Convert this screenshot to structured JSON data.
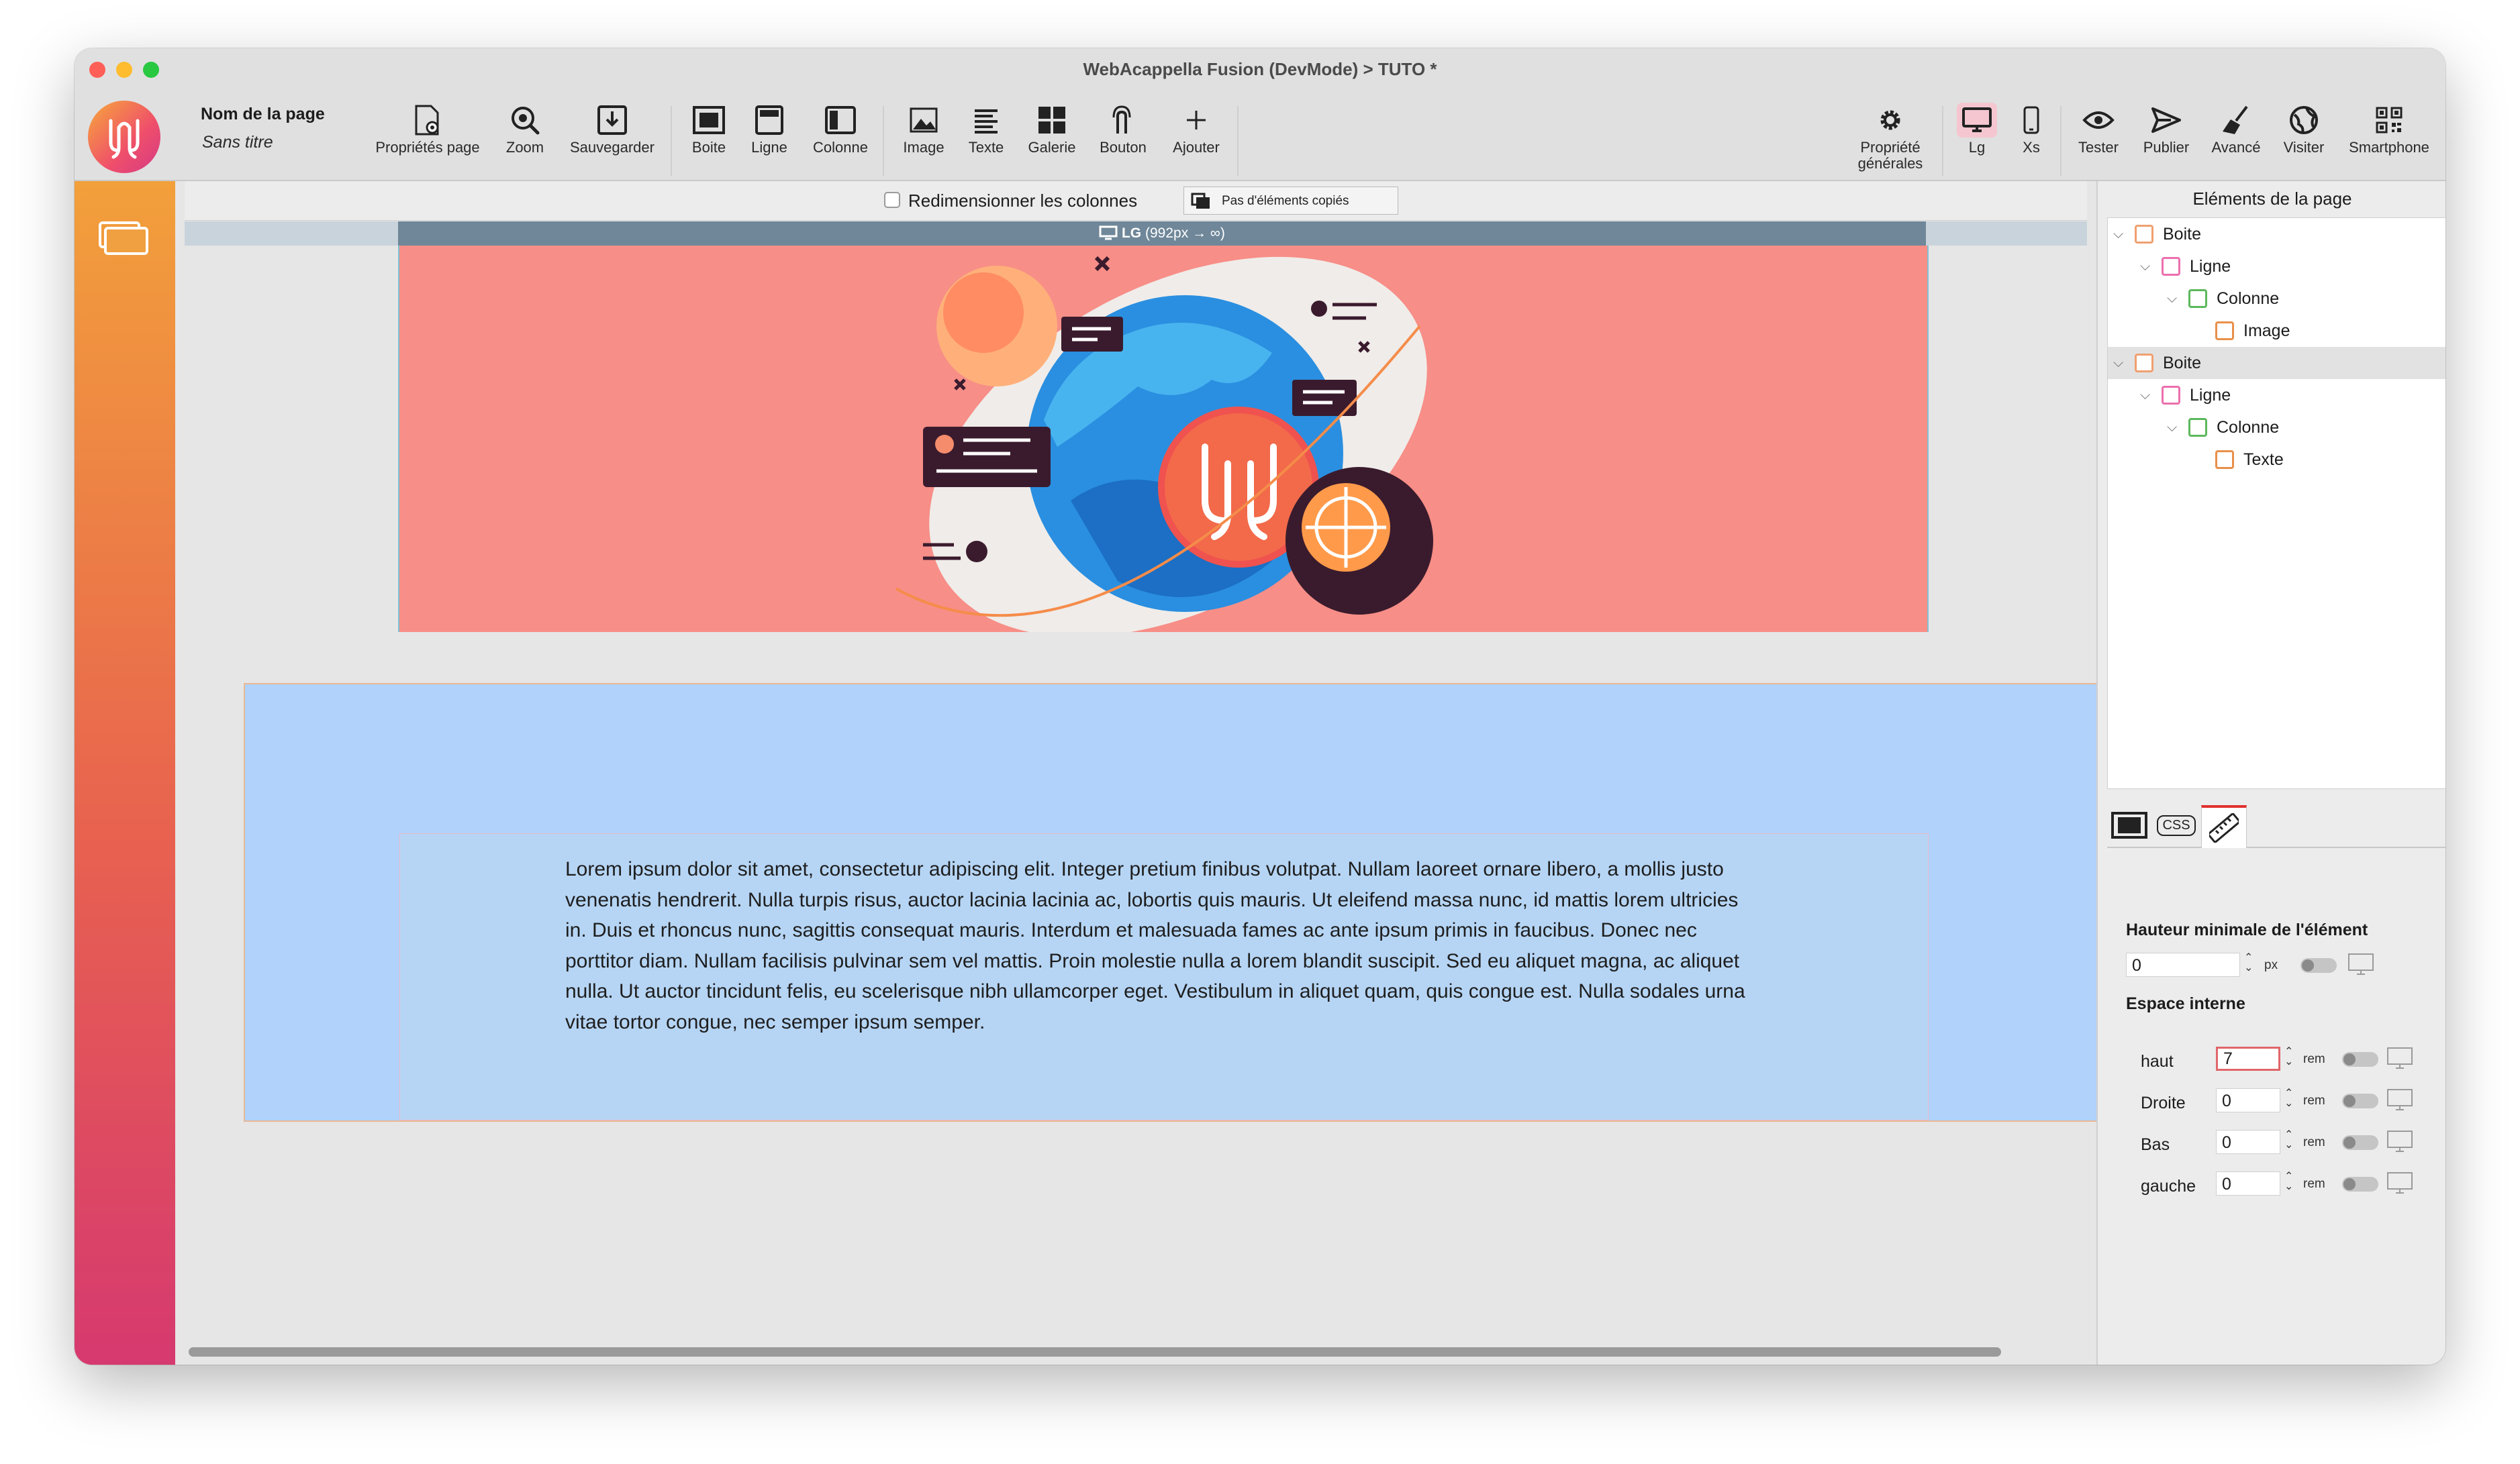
{
  "window": {
    "title": "WebAcappella Fusion (DevMode) > TUTO *"
  },
  "page": {
    "name_label": "Nom de la page",
    "subtitle": "Sans titre"
  },
  "toolbar": {
    "left": [
      {
        "id": "page-properties",
        "label": "Propriétés page",
        "icon": "page-gear-icon"
      },
      {
        "id": "zoom",
        "label": "Zoom",
        "icon": "zoom-icon"
      },
      {
        "id": "save",
        "label": "Sauvegarder",
        "icon": "save-icon"
      },
      {
        "id": "box",
        "label": "Boite",
        "icon": "box-icon"
      },
      {
        "id": "row",
        "label": "Ligne",
        "icon": "row-icon"
      },
      {
        "id": "column",
        "label": "Colonne",
        "icon": "column-icon"
      },
      {
        "id": "image",
        "label": "Image",
        "icon": "image-icon"
      },
      {
        "id": "text",
        "label": "Texte",
        "icon": "text-icon"
      },
      {
        "id": "gallery",
        "label": "Galerie",
        "icon": "gallery-icon"
      },
      {
        "id": "button",
        "label": "Bouton",
        "icon": "touch-icon"
      },
      {
        "id": "add",
        "label": "Ajouter",
        "icon": "plus-icon"
      }
    ],
    "right": [
      {
        "id": "general-props",
        "label_line1": "Propriété",
        "label_line2": "générales",
        "icon": "gear-icon"
      },
      {
        "id": "lg",
        "label": "Lg",
        "icon": "desktop-icon"
      },
      {
        "id": "xs",
        "label": "Xs",
        "icon": "phone-icon"
      },
      {
        "id": "test",
        "label": "Tester",
        "icon": "eye-icon"
      },
      {
        "id": "publish",
        "label": "Publier",
        "icon": "send-icon"
      },
      {
        "id": "advanced",
        "label": "Avancé",
        "icon": "broom-icon"
      },
      {
        "id": "visit",
        "label": "Visiter",
        "icon": "globe-icon"
      },
      {
        "id": "smartphone",
        "label": "Smartphone",
        "icon": "qr-code-icon"
      }
    ]
  },
  "canvas": {
    "resize_columns_label": "Redimensionner les colonnes",
    "copied_elements_label": "Pas d'éléments copiés",
    "breakpoint_label": "LG",
    "breakpoint_range": "(992px → ∞)",
    "lorem_text": "Lorem ipsum dolor sit amet, consectetur adipiscing elit. Integer pretium finibus volutpat. Nullam laoreet ornare libero, a mollis justo venenatis hendrerit. Nulla turpis risus, auctor lacinia lacinia ac, lobortis quis mauris. Ut eleifend massa nunc, id mattis lorem ultricies in. Duis et rhoncus nunc, sagittis consequat mauris. Interdum et malesuada fames ac ante ipsum primis in faucibus. Donec nec porttitor diam. Nullam facilisis pulvinar sem vel mattis. Proin molestie nulla a lorem blandit suscipit. Sed eu aliquet magna, ac aliquet nulla. Ut auctor tincidunt felis, eu scelerisque nibh ullamcorper eget. Vestibulum in aliquet quam, quis congue est. Nulla sodales urna vitae tortor congue, nec semper ipsum semper."
  },
  "panel": {
    "title": "Eléments de la page",
    "tree": [
      {
        "label": "Boite",
        "type": "box",
        "color": "#f0a070"
      },
      {
        "label": "Ligne",
        "type": "row",
        "color": "#ec6fae"
      },
      {
        "label": "Colonne",
        "type": "column",
        "color": "#5cb85c"
      },
      {
        "label": "Image",
        "type": "image",
        "color": "#e8904a"
      },
      {
        "label": "Boite",
        "type": "box",
        "color": "#f0a070"
      },
      {
        "label": "Ligne",
        "type": "row",
        "color": "#ec6fae"
      },
      {
        "label": "Colonne",
        "type": "column",
        "color": "#5cb85c"
      },
      {
        "label": "Texte",
        "type": "text",
        "color": "#e8904a"
      }
    ],
    "tab_css": "CSS",
    "min_height_label": "Hauteur minimale de l'élément",
    "min_height_value": "0",
    "min_height_unit": "px",
    "padding_title": "Espace interne",
    "padding": [
      {
        "label": "haut",
        "value": "7",
        "unit": "rem"
      },
      {
        "label": "Droite",
        "value": "0",
        "unit": "rem"
      },
      {
        "label": "Bas",
        "value": "0",
        "unit": "rem"
      },
      {
        "label": "gauche",
        "value": "0",
        "unit": "rem"
      }
    ]
  }
}
